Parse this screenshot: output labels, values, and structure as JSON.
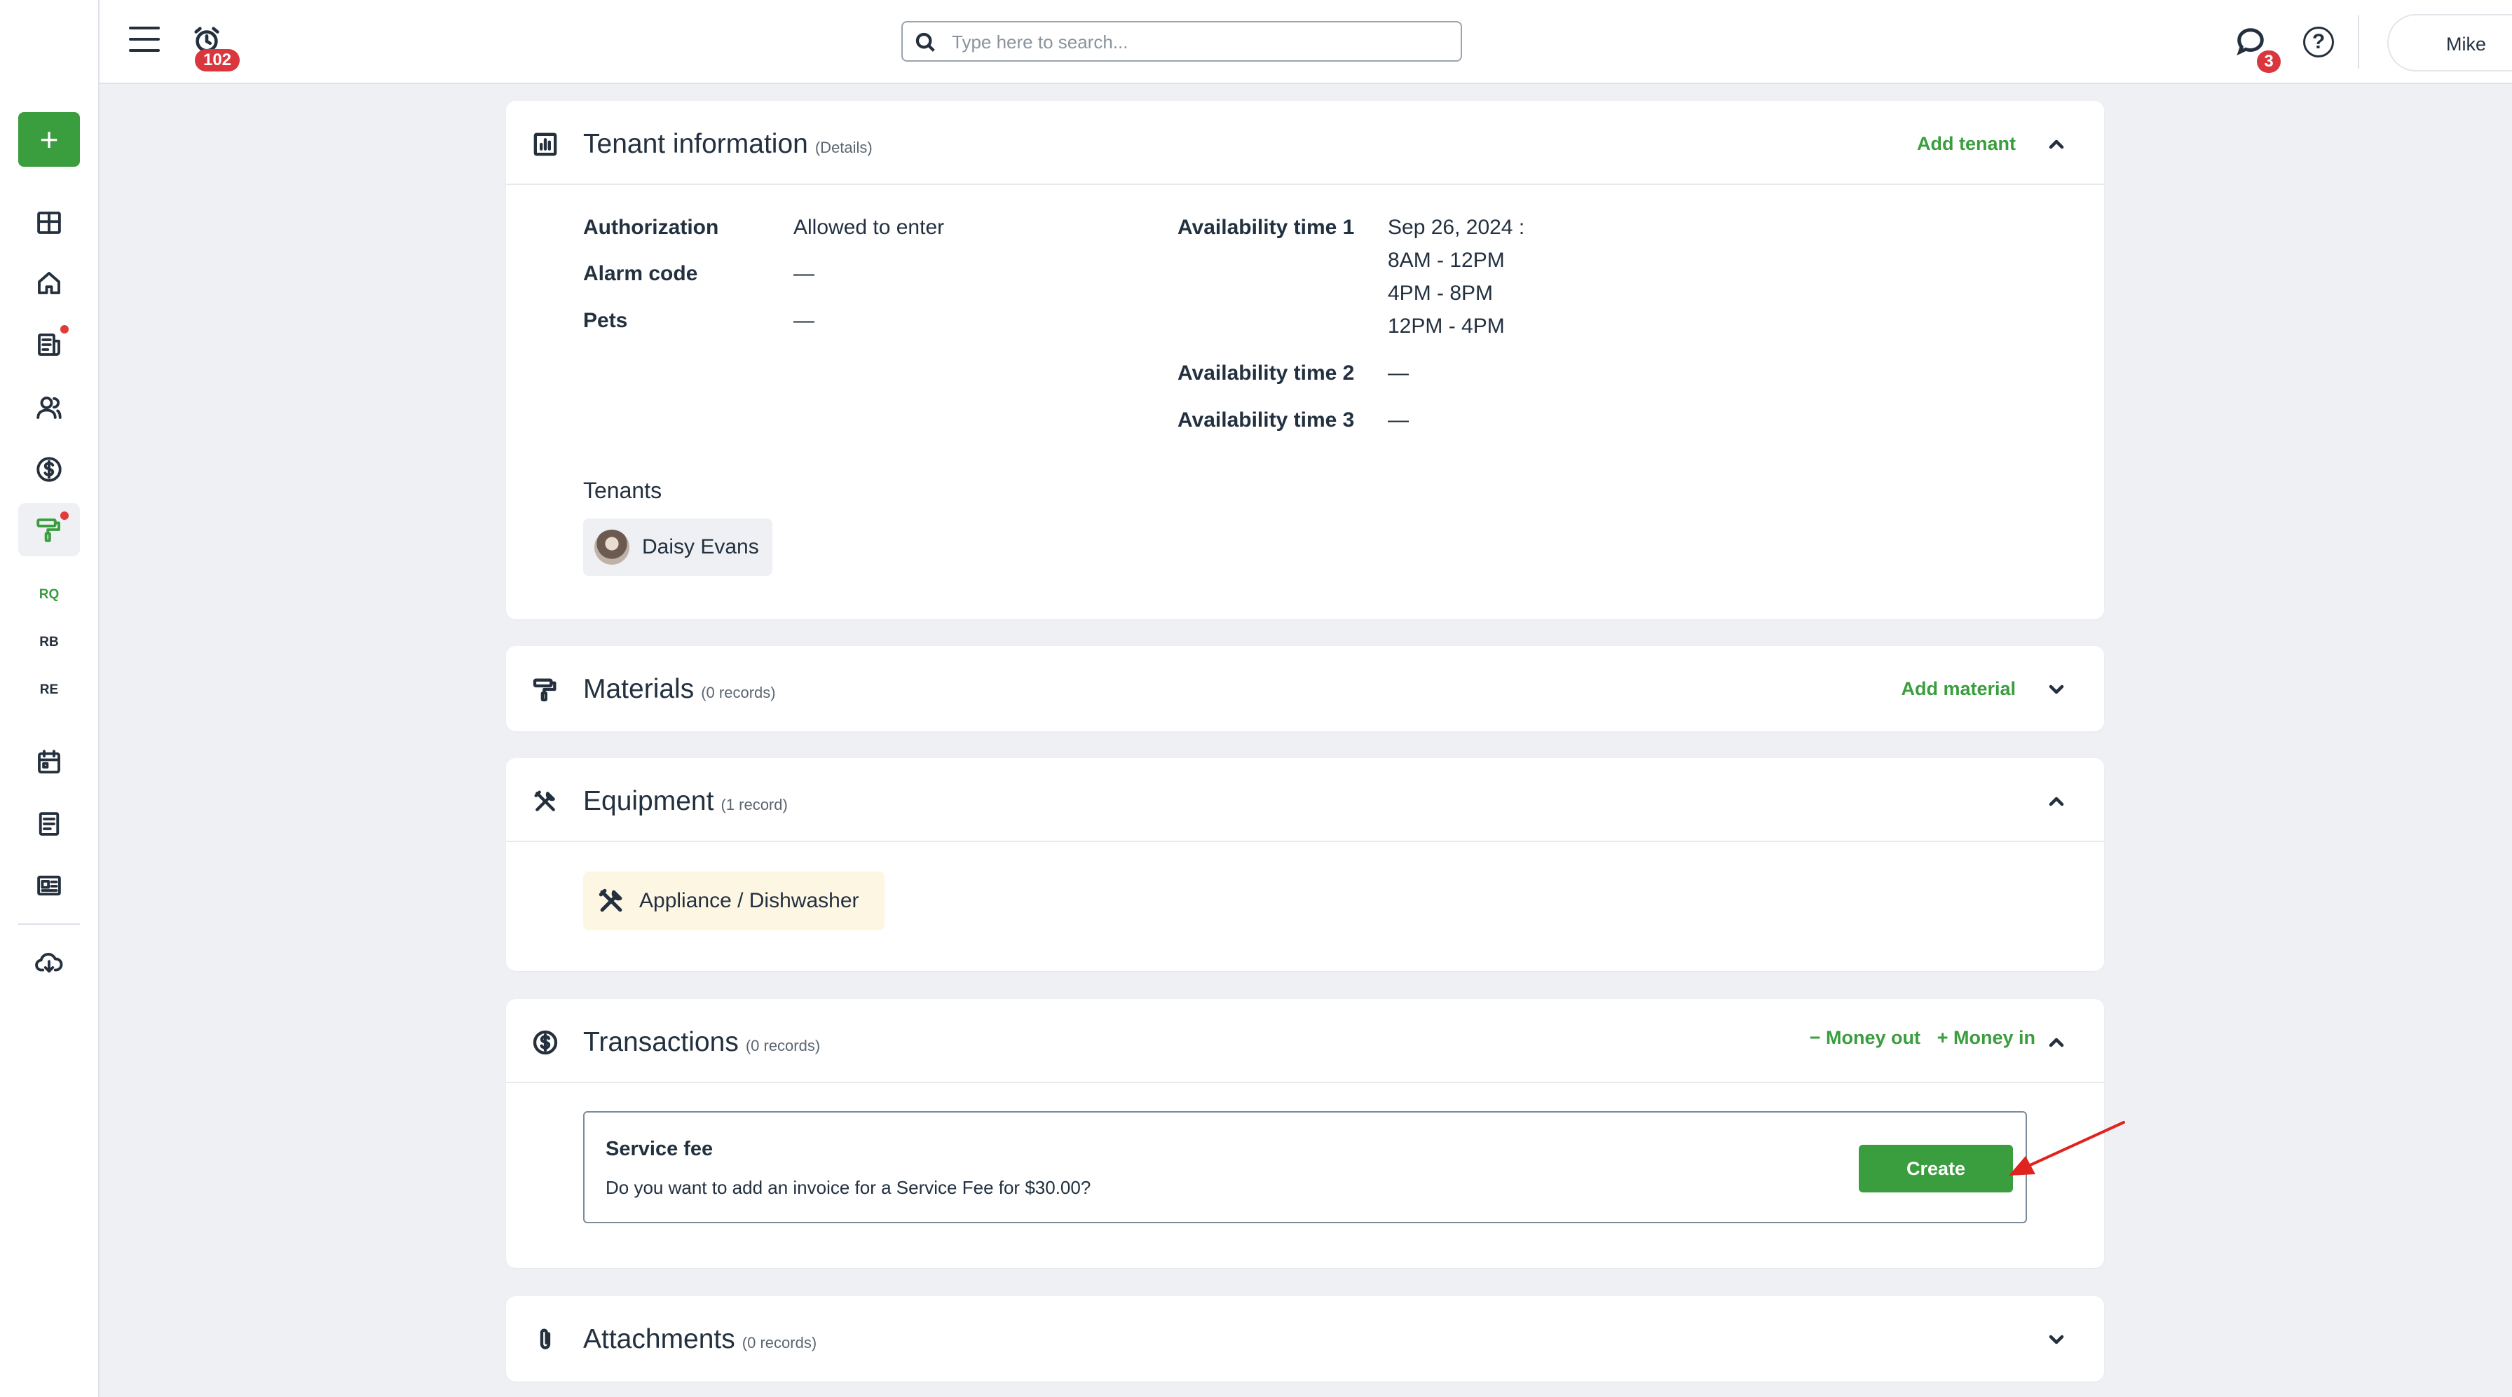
{
  "topbar": {
    "notifications_count": "102",
    "search_placeholder": "Type here to search...",
    "messages_count": "3",
    "help_label": "?",
    "user_name": "Mike"
  },
  "sidebar": {
    "add_label": "+",
    "abbr": [
      "RQ",
      "RB",
      "RE"
    ],
    "icons": [
      "dashboard-icon",
      "home-icon",
      "reports-icon",
      "people-icon",
      "dollar-icon",
      "paint-roller-icon",
      "calendar-icon",
      "document-icon",
      "id-card-icon",
      "cloud-download-icon"
    ]
  },
  "tenant_info": {
    "title": "Tenant information",
    "subtitle": "(Details)",
    "action": "Add tenant",
    "fields_left": [
      {
        "label": "Authorization",
        "value": "Allowed to enter"
      },
      {
        "label": "Alarm code",
        "value": "—"
      },
      {
        "label": "Pets",
        "value": "—"
      }
    ],
    "availability": [
      {
        "label": "Availability time 1",
        "lines": [
          "Sep 26, 2024 :",
          "8AM - 12PM",
          "4PM - 8PM",
          "12PM - 4PM"
        ]
      },
      {
        "label": "Availability time 2",
        "value": "—"
      },
      {
        "label": "Availability time 3",
        "value": "—"
      }
    ],
    "tenants_label": "Tenants",
    "tenant_name": "Daisy Evans"
  },
  "materials": {
    "title": "Materials",
    "subtitle": "(0 records)",
    "action": "Add material"
  },
  "equipment": {
    "title": "Equipment",
    "subtitle": "(1 record)",
    "item": "Appliance / Dishwasher"
  },
  "transactions": {
    "title": "Transactions",
    "subtitle": "(0 records)",
    "money_out": "− Money out",
    "money_in": "+ Money in",
    "service_title": "Service fee",
    "service_text": "Do you want to add an invoice for a Service Fee for $30.00?",
    "create_label": "Create"
  },
  "attachments": {
    "title": "Attachments",
    "subtitle": "(0 records)"
  },
  "colors": {
    "accent": "#3a9d3e",
    "badge": "#d9363e",
    "arrow": "#e0231f",
    "background": "#eef0f4"
  }
}
